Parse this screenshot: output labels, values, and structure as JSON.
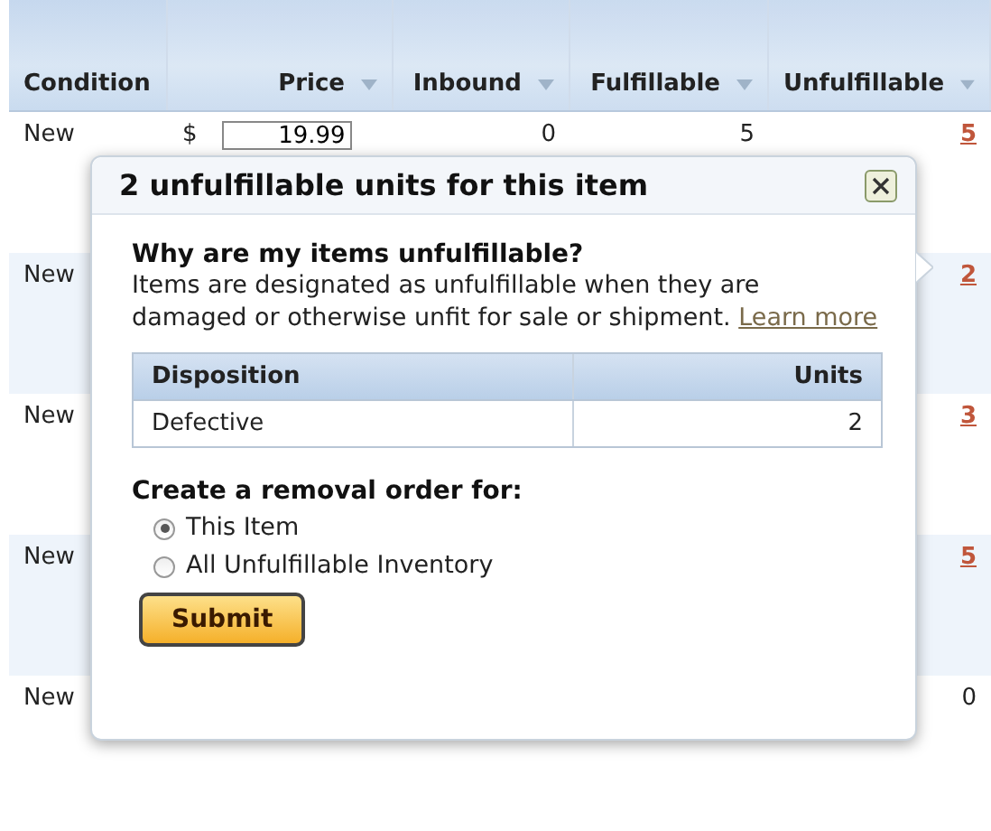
{
  "table": {
    "columns": [
      {
        "label": "Condition",
        "sortable": false
      },
      {
        "label": "Price",
        "sortable": true
      },
      {
        "label": "Inbound",
        "sortable": true
      },
      {
        "label": "Fulfillable",
        "sortable": true
      },
      {
        "label": "Unfulfillable",
        "sortable": true
      }
    ],
    "rows": [
      {
        "condition": "New",
        "currency": "$",
        "price": "19.99",
        "inbound": "0",
        "fulfillable": "5",
        "unfulfillable": "5"
      },
      {
        "condition": "New",
        "unfulfillable": "2"
      },
      {
        "condition": "New",
        "unfulfillable": "3"
      },
      {
        "condition": "New",
        "unfulfillable": "5"
      },
      {
        "condition": "New",
        "unfulfillable": "0",
        "unfulfillable_link": false
      }
    ]
  },
  "popup": {
    "title": "2 unfulfillable units for this item",
    "question": "Why are my items unfulfillable?",
    "explanation": "Items are designated as unfulfillable when they are damaged or otherwise unfit for sale or shipment.",
    "link": "Learn more",
    "disposition_table": {
      "columns": [
        "Disposition",
        "Units"
      ],
      "rows": [
        [
          "Defective",
          "2"
        ]
      ]
    },
    "removal_heading": "Create a removal order for:",
    "options": [
      {
        "label": "This Item",
        "selected": true
      },
      {
        "label": "All Unfulfillable Inventory",
        "selected": false
      }
    ],
    "submit": "Submit"
  }
}
